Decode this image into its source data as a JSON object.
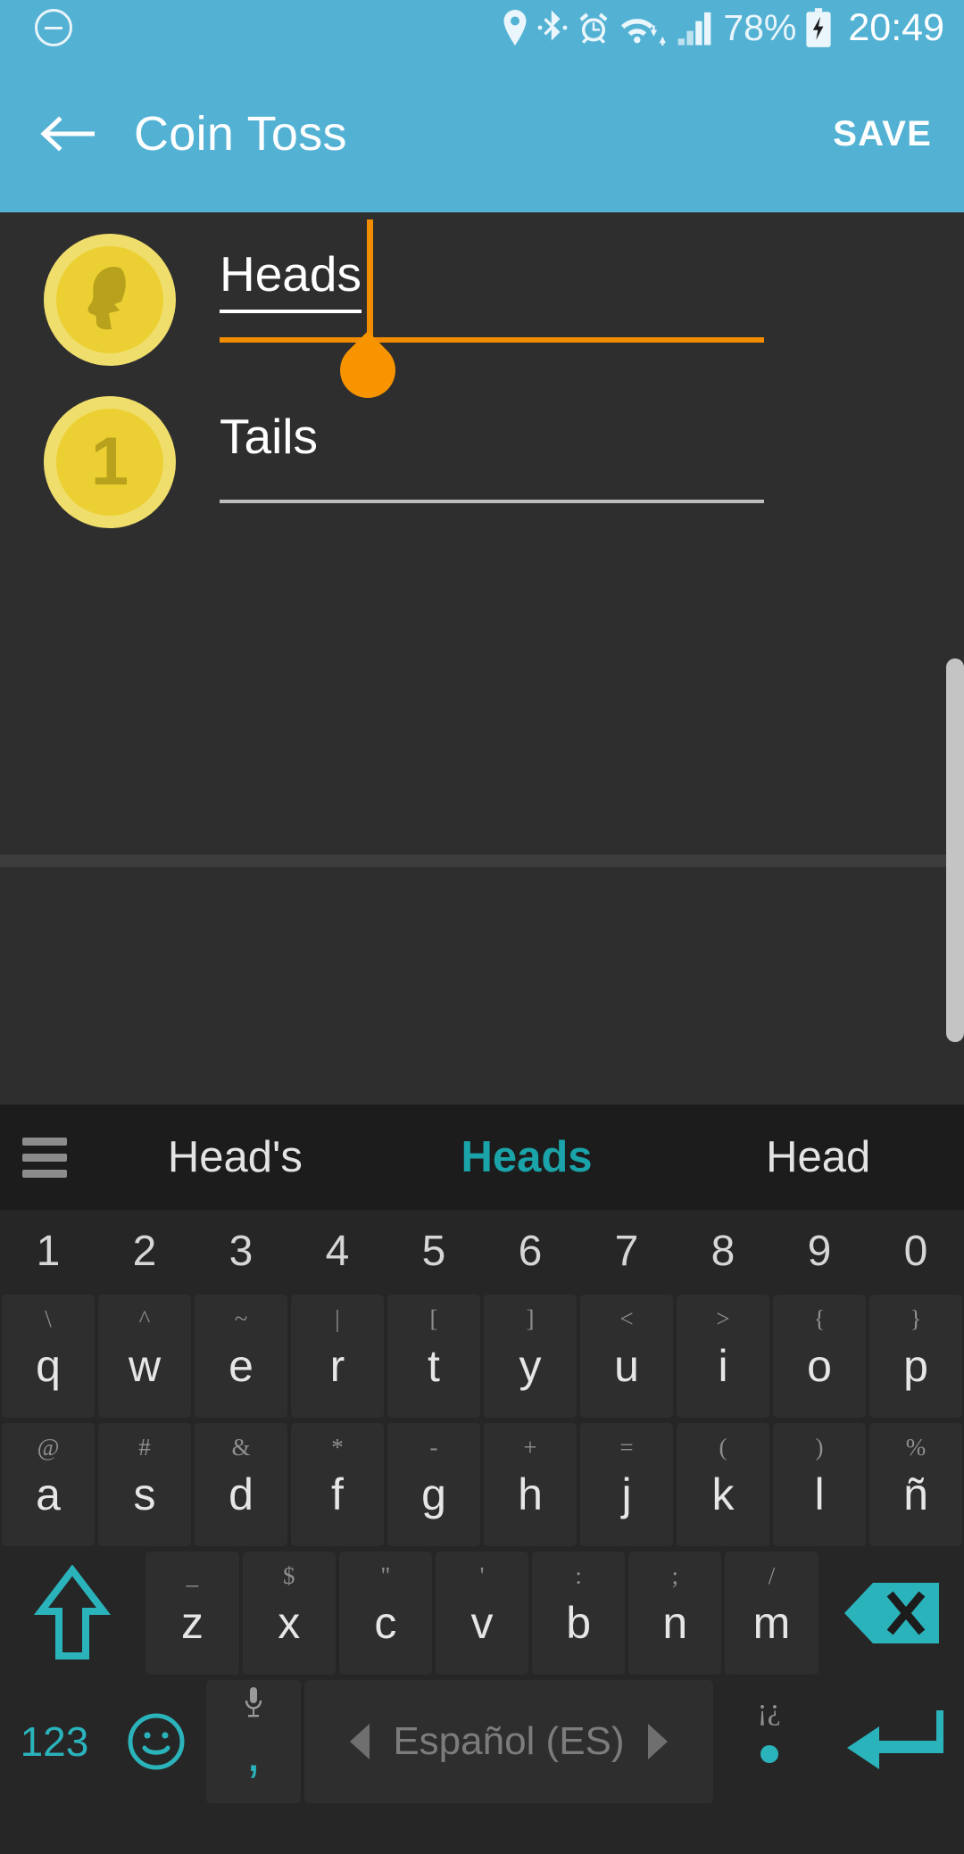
{
  "statusbar": {
    "icons": [
      "mute-icon",
      "location-icon",
      "bluetooth-icon",
      "alarm-icon",
      "wifi-icon",
      "signal-icon"
    ],
    "battery_percent": "78%",
    "battery_icon": "battery-charging-icon",
    "time": "20:49"
  },
  "appbar": {
    "back_icon": "back-arrow-icon",
    "title": "Coin Toss",
    "save_label": "SAVE",
    "bg_color": "#53b2d4"
  },
  "main": {
    "fields": [
      {
        "icon": "coin-heads-icon",
        "icon_symbol": "",
        "value": "Heads",
        "focused": true
      },
      {
        "icon": "coin-tails-icon",
        "icon_symbol": "1",
        "value": "Tails",
        "focused": false
      }
    ],
    "accent_color": "#f28c00",
    "coin_color": "#ecd033"
  },
  "keyboard": {
    "menu_icon": "hamburger-menu-icon",
    "suggestions": [
      {
        "text": "Head's",
        "active": false
      },
      {
        "text": "Heads",
        "active": true
      },
      {
        "text": "Head",
        "active": false
      }
    ],
    "numbers": [
      "1",
      "2",
      "3",
      "4",
      "5",
      "6",
      "7",
      "8",
      "9",
      "0"
    ],
    "row1": [
      {
        "main": "q",
        "alt": "\\"
      },
      {
        "main": "w",
        "alt": "^"
      },
      {
        "main": "e",
        "alt": "~"
      },
      {
        "main": "r",
        "alt": "|"
      },
      {
        "main": "t",
        "alt": "["
      },
      {
        "main": "y",
        "alt": "]"
      },
      {
        "main": "u",
        "alt": "<"
      },
      {
        "main": "i",
        "alt": ">"
      },
      {
        "main": "o",
        "alt": "{"
      },
      {
        "main": "p",
        "alt": "}"
      }
    ],
    "row2": [
      {
        "main": "a",
        "alt": "@"
      },
      {
        "main": "s",
        "alt": "#"
      },
      {
        "main": "d",
        "alt": "&"
      },
      {
        "main": "f",
        "alt": "*"
      },
      {
        "main": "g",
        "alt": "-"
      },
      {
        "main": "h",
        "alt": "+"
      },
      {
        "main": "j",
        "alt": "="
      },
      {
        "main": "k",
        "alt": "("
      },
      {
        "main": "l",
        "alt": ")"
      },
      {
        "main": "ñ",
        "alt": "%"
      }
    ],
    "row3": [
      {
        "main": "z",
        "alt": "_"
      },
      {
        "main": "x",
        "alt": "$"
      },
      {
        "main": "c",
        "alt": "\""
      },
      {
        "main": "v",
        "alt": "'"
      },
      {
        "main": "b",
        "alt": ":"
      },
      {
        "main": "n",
        "alt": ";"
      },
      {
        "main": "m",
        "alt": "/"
      }
    ],
    "shift_icon": "shift-up-arrow-icon",
    "backspace_icon": "backspace-delete-icon",
    "numeric_label": "123",
    "emoji_icon": "emoji-smiley-icon",
    "mic_icon": "microphone-icon",
    "comma_label": ",",
    "space_label": "Español (ES)",
    "space_prev_icon": "left-triangle-icon",
    "space_next_icon": "right-triangle-icon",
    "period_alt": "¡¿",
    "period_label": ".",
    "enter_icon": "enter-return-icon",
    "accent_color": "#2bb3bb"
  }
}
